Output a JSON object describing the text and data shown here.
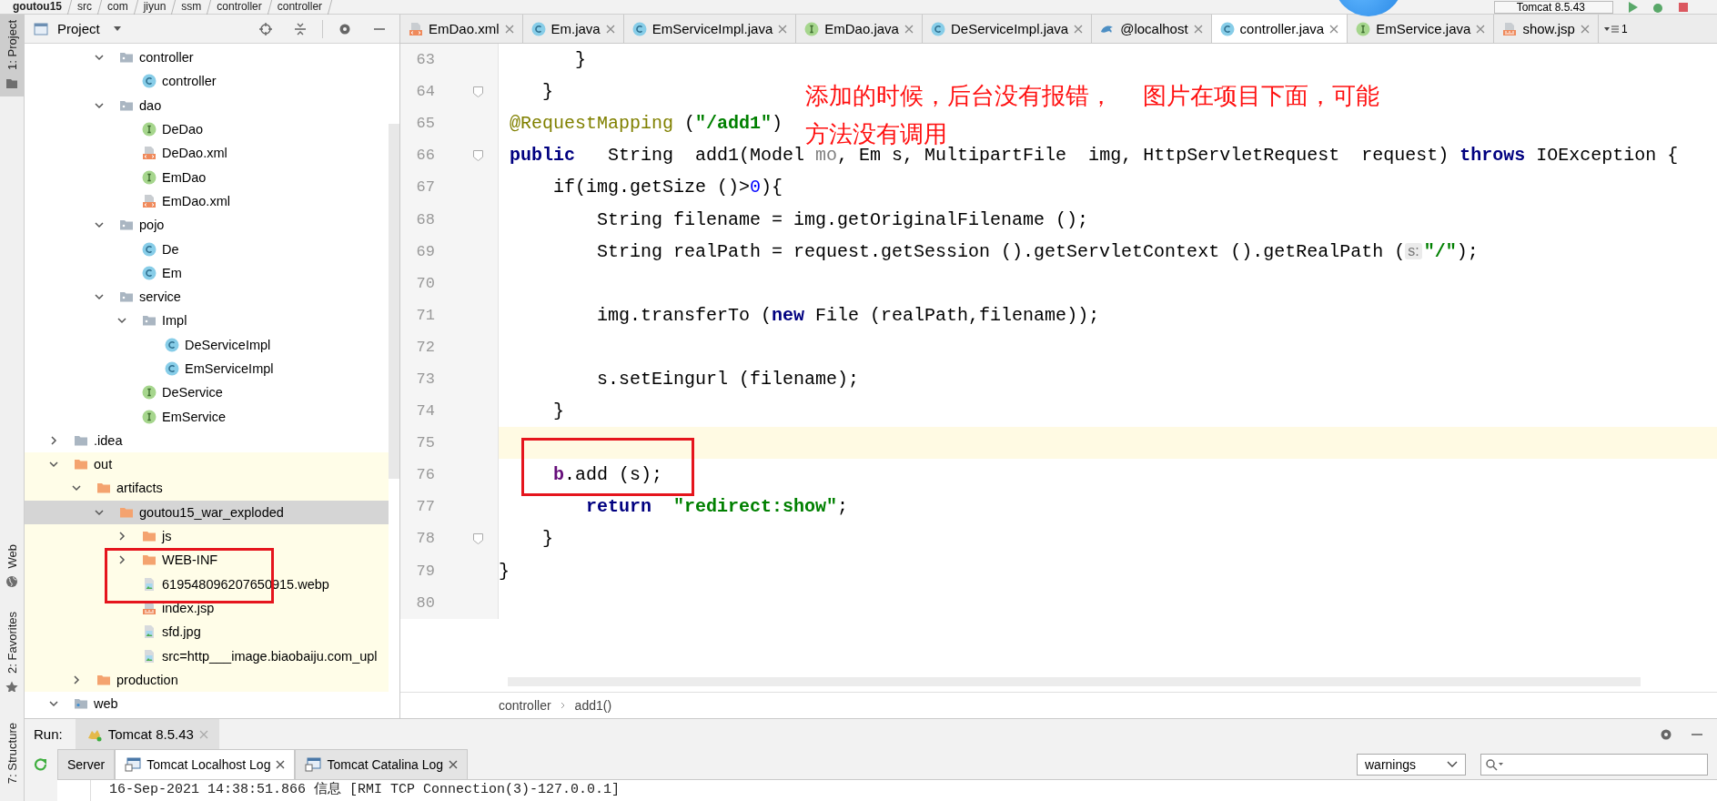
{
  "breadcrumb": [
    "goutou15",
    "src",
    "com",
    "jiyun",
    "ssm",
    "controller",
    "controller"
  ],
  "run_config": "Tomcat 8.5.43",
  "tool_stripe": [
    {
      "label": "1: Project",
      "selected": true,
      "kind": "project"
    },
    {
      "label": "Web",
      "selected": false,
      "kind": "web"
    },
    {
      "label": "2: Favorites",
      "selected": false,
      "kind": "favorites"
    },
    {
      "label": "7: Structure",
      "selected": false,
      "kind": "structure"
    }
  ],
  "project_panel": {
    "title": "Project"
  },
  "tree": {
    "continued": [
      {
        "label": "controller",
        "kind": "package",
        "expanded": true,
        "selected": false,
        "children": [
          {
            "label": "controller",
            "kind": "class",
            "selected": false
          }
        ]
      },
      {
        "label": "dao",
        "kind": "package",
        "expanded": true,
        "selected": false,
        "children": [
          {
            "label": "DeDao",
            "kind": "interface",
            "selected": false
          },
          {
            "label": "DeDao.xml",
            "kind": "xml",
            "selected": false
          },
          {
            "label": "EmDao",
            "kind": "interface",
            "selected": false
          },
          {
            "label": "EmDao.xml",
            "kind": "xml",
            "selected": false
          }
        ]
      },
      {
        "label": "pojo",
        "kind": "package",
        "expanded": true,
        "selected": false,
        "children": [
          {
            "label": "De",
            "kind": "class",
            "selected": false
          },
          {
            "label": "Em",
            "kind": "class",
            "selected": false
          }
        ]
      },
      {
        "label": "service",
        "kind": "package",
        "expanded": true,
        "selected": false,
        "children": [
          {
            "label": "Impl",
            "kind": "package",
            "expanded": true,
            "selected": false,
            "children": [
              {
                "label": "DeServiceImpl",
                "kind": "class",
                "selected": false
              },
              {
                "label": "EmServiceImpl",
                "kind": "class",
                "selected": false
              }
            ]
          },
          {
            "label": "DeService",
            "kind": "interface",
            "selected": false
          },
          {
            "label": "EmService",
            "kind": "interface",
            "selected": false
          }
        ]
      }
    ],
    "items": [
      {
        "label": ".idea",
        "kind": "folder",
        "expanded": false,
        "selected": false
      },
      {
        "label": "out",
        "kind": "excluded-folder",
        "expanded": true,
        "selected": false,
        "children": [
          {
            "label": "artifacts",
            "kind": "excluded-folder",
            "expanded": true,
            "selected": false,
            "children": [
              {
                "label": "goutou15_war_exploded",
                "kind": "excluded-folder",
                "expanded": true,
                "selected": true,
                "children": [
                  {
                    "label": "js",
                    "kind": "excluded-folder",
                    "expanded": false,
                    "selected": false
                  },
                  {
                    "label": "WEB-INF",
                    "kind": "excluded-folder",
                    "expanded": false,
                    "selected": false
                  },
                  {
                    "label": "619548096207650915.webp",
                    "kind": "image",
                    "selected": false
                  },
                  {
                    "label": "index.jsp",
                    "kind": "jsp",
                    "selected": false
                  },
                  {
                    "label": "sfd.jpg",
                    "kind": "image",
                    "selected": false
                  },
                  {
                    "label": "src=http___image.biaobaiju.com_upl",
                    "kind": "image",
                    "selected": false
                  }
                ]
              }
            ]
          },
          {
            "label": "production",
            "kind": "excluded-folder",
            "expanded": false,
            "selected": false
          }
        ]
      },
      {
        "label": "web",
        "kind": "web-folder",
        "expanded": true,
        "selected": false
      }
    ]
  },
  "editor_tabs": [
    {
      "label": "EmDao.xml",
      "kind": "xml",
      "selected": false
    },
    {
      "label": "Em.java",
      "kind": "class",
      "selected": false
    },
    {
      "label": "EmServiceImpl.java",
      "kind": "class",
      "selected": false
    },
    {
      "label": "EmDao.java",
      "kind": "interface",
      "selected": false
    },
    {
      "label": "DeServiceImpl.java",
      "kind": "class",
      "selected": false
    },
    {
      "label": "@localhost",
      "kind": "db",
      "selected": false
    },
    {
      "label": "controller.java",
      "kind": "class",
      "selected": true
    },
    {
      "label": "EmService.java",
      "kind": "interface",
      "selected": false
    },
    {
      "label": "show.jsp",
      "kind": "jsp",
      "selected": false
    }
  ],
  "hidden_tab_count": "1",
  "code": {
    "lines": [
      {
        "number": "63",
        "current": false,
        "fold": false,
        "tokens": [
          {
            "text": "       }",
            "kind": "plain"
          }
        ]
      },
      {
        "number": "64",
        "current": false,
        "fold": true,
        "tokens": [
          {
            "text": "    }",
            "kind": "plain"
          }
        ]
      },
      {
        "number": "65",
        "current": false,
        "fold": false,
        "tokens": [
          {
            "text": " @RequestMapping",
            "kind": "annotation"
          },
          {
            "text": " (",
            "kind": "plain"
          },
          {
            "text": "\"/add1\"",
            "kind": "string"
          },
          {
            "text": ")",
            "kind": "plain"
          }
        ]
      },
      {
        "number": "66",
        "current": false,
        "fold": true,
        "tokens": [
          {
            "text": " public",
            "kind": "keyword"
          },
          {
            "text": "   String  add1(Model ",
            "kind": "plain"
          },
          {
            "text": "mo",
            "kind": "unused"
          },
          {
            "text": ", Em s, MultipartFile  img, HttpServletRequest  request) ",
            "kind": "plain"
          },
          {
            "text": "throws",
            "kind": "keyword"
          },
          {
            "text": " IOException {",
            "kind": "plain"
          }
        ]
      },
      {
        "number": "67",
        "current": false,
        "fold": false,
        "tokens": [
          {
            "text": "     if(img.getSize ()>",
            "kind": "plain"
          },
          {
            "text": "0",
            "kind": "number"
          },
          {
            "text": "){",
            "kind": "plain"
          }
        ]
      },
      {
        "number": "68",
        "current": false,
        "fold": false,
        "tokens": [
          {
            "text": "         String filename = img.getOriginalFilename ();",
            "kind": "plain"
          }
        ]
      },
      {
        "number": "69",
        "current": false,
        "fold": false,
        "tokens": [
          {
            "text": "         String realPath = request.getSession ().getServletContext ().getRealPath (",
            "kind": "plain"
          },
          {
            "text": "s:",
            "kind": "hint"
          },
          {
            "text": "\"/\"",
            "kind": "string"
          },
          {
            "text": ");",
            "kind": "plain"
          }
        ]
      },
      {
        "number": "70",
        "current": false,
        "fold": false
      },
      {
        "number": "71",
        "current": false,
        "fold": false,
        "tokens": [
          {
            "text": "         img.transferTo (",
            "kind": "plain"
          },
          {
            "text": "new",
            "kind": "keyword"
          },
          {
            "text": " File (realPath,filename));",
            "kind": "plain"
          }
        ]
      },
      {
        "number": "72",
        "current": false,
        "fold": false
      },
      {
        "number": "73",
        "current": false,
        "fold": false,
        "tokens": [
          {
            "text": "         s.setEingurl (filename);",
            "kind": "plain"
          }
        ]
      },
      {
        "number": "74",
        "current": false,
        "fold": false,
        "tokens": [
          {
            "text": "     }",
            "kind": "plain"
          }
        ]
      },
      {
        "number": "75",
        "current": true,
        "fold": false
      },
      {
        "number": "76",
        "current": false,
        "fold": false,
        "tokens": [
          {
            "text": "     b",
            "kind": "field"
          },
          {
            "text": ".add (s);",
            "kind": "plain"
          }
        ]
      },
      {
        "number": "77",
        "current": false,
        "fold": false,
        "tokens": [
          {
            "text": "        return",
            "kind": "keyword"
          },
          {
            "text": "  \"redirect:show\"",
            "kind": "string"
          },
          {
            "text": ";",
            "kind": "plain"
          }
        ]
      },
      {
        "number": "78",
        "current": false,
        "fold": true,
        "tokens": [
          {
            "text": "    }",
            "kind": "plain"
          }
        ]
      },
      {
        "number": "79",
        "current": false,
        "fold": false,
        "tokens": [
          {
            "text": "}",
            "kind": "plain"
          }
        ]
      },
      {
        "number": "80",
        "current": false,
        "fold": false
      }
    ]
  },
  "annotation": {
    "lines": [
      "添加的时候，后台没有报错，    图片在项目下面，可能",
      "方法没有调用"
    ]
  },
  "editor_breadcrumb": [
    "controller",
    "add1()"
  ],
  "run_panel": {
    "label": "Run:",
    "tabs": [
      {
        "label": "Tomcat 8.5.43",
        "selected": true
      }
    ],
    "log_tabs": [
      {
        "label": "Server",
        "selected": false,
        "kind": "plain"
      },
      {
        "label": "Tomcat Localhost Log",
        "selected": true,
        "kind": "log"
      },
      {
        "label": "Tomcat Catalina Log",
        "selected": false,
        "kind": "log"
      }
    ],
    "filter": "warnings",
    "log_lines": [
      "16-Sep-2021 14:38:51.866 信息 [RMI TCP Connection(3)-127.0.0.1]"
    ]
  }
}
